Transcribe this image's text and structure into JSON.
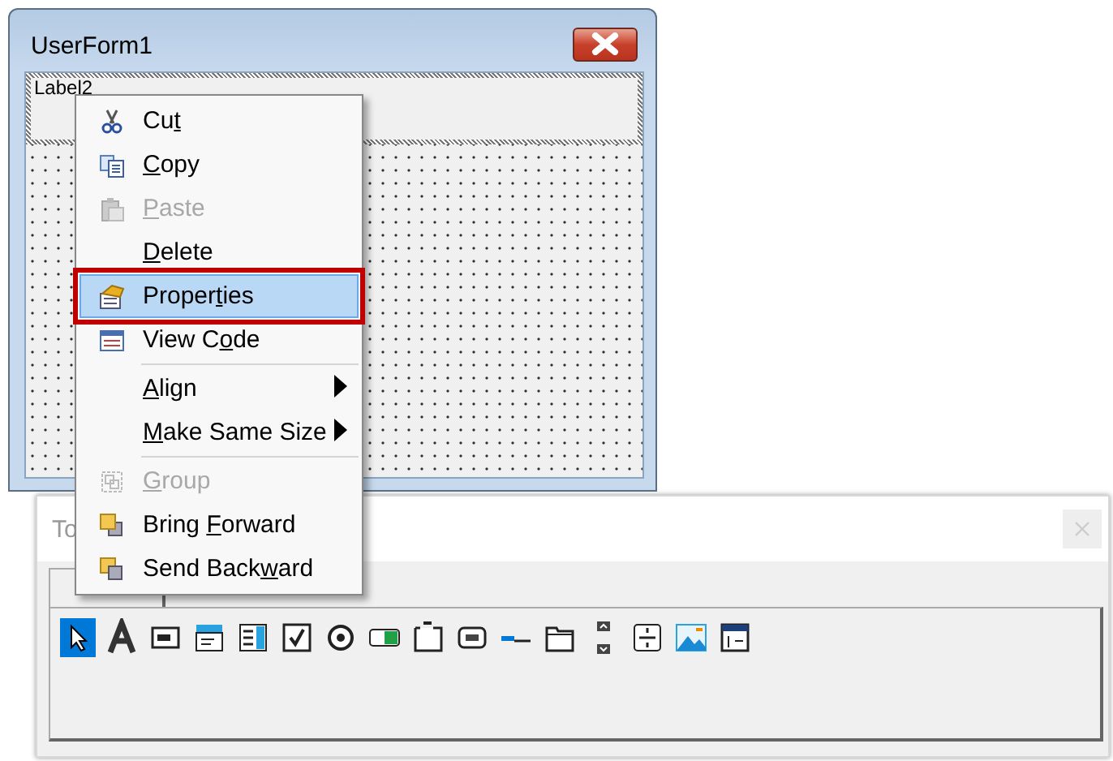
{
  "form_window": {
    "title": "UserForm1",
    "label": "Label2"
  },
  "context_menu": {
    "items": [
      {
        "kind": "item",
        "label": {
          "before": "Cu",
          "key": "t"
        },
        "disabled": false,
        "selected": false,
        "submenu": false
      },
      {
        "kind": "item",
        "label": {
          "key": "C",
          "after": "opy"
        },
        "disabled": false,
        "selected": false,
        "submenu": false
      },
      {
        "kind": "item",
        "label": {
          "key": "P",
          "after": "aste"
        },
        "disabled": true,
        "selected": false,
        "submenu": false
      },
      {
        "kind": "item",
        "label": {
          "key": "D",
          "after": "elete"
        },
        "disabled": false,
        "selected": false,
        "submenu": false
      },
      {
        "kind": "item",
        "label": {
          "before": "Proper",
          "key": "t",
          "after": "ies"
        },
        "disabled": false,
        "selected": true,
        "submenu": false
      },
      {
        "kind": "item",
        "label": {
          "before": "View C",
          "key": "o",
          "after": "de"
        },
        "disabled": false,
        "selected": false,
        "submenu": false
      },
      {
        "kind": "separator"
      },
      {
        "kind": "item",
        "label": {
          "key": "A",
          "after": "lign"
        },
        "disabled": false,
        "selected": false,
        "submenu": true
      },
      {
        "kind": "item",
        "label": {
          "key": "M",
          "after": "ake Same Size"
        },
        "disabled": false,
        "selected": false,
        "submenu": true
      },
      {
        "kind": "separator"
      },
      {
        "kind": "item",
        "label": {
          "key": "G",
          "after": "roup"
        },
        "disabled": true,
        "selected": false,
        "submenu": false
      },
      {
        "kind": "item",
        "label": {
          "before": "Bring ",
          "key": "F",
          "after": "orward"
        },
        "disabled": false,
        "selected": false,
        "submenu": false
      },
      {
        "kind": "item",
        "label": {
          "before": "Send Back",
          "key": "w",
          "after": "ard"
        },
        "disabled": false,
        "selected": false,
        "submenu": false
      }
    ]
  },
  "toolbox": {
    "title": "To",
    "tools": [
      {
        "selected": true
      },
      {
        "selected": false
      },
      {
        "selected": false
      },
      {
        "selected": false
      },
      {
        "selected": false
      },
      {
        "selected": false
      },
      {
        "selected": false
      },
      {
        "selected": false
      },
      {
        "selected": false
      },
      {
        "selected": false
      },
      {
        "selected": false
      },
      {
        "selected": false
      },
      {
        "selected": false
      },
      {
        "selected": false
      },
      {
        "selected": false
      },
      {
        "selected": false
      }
    ]
  }
}
